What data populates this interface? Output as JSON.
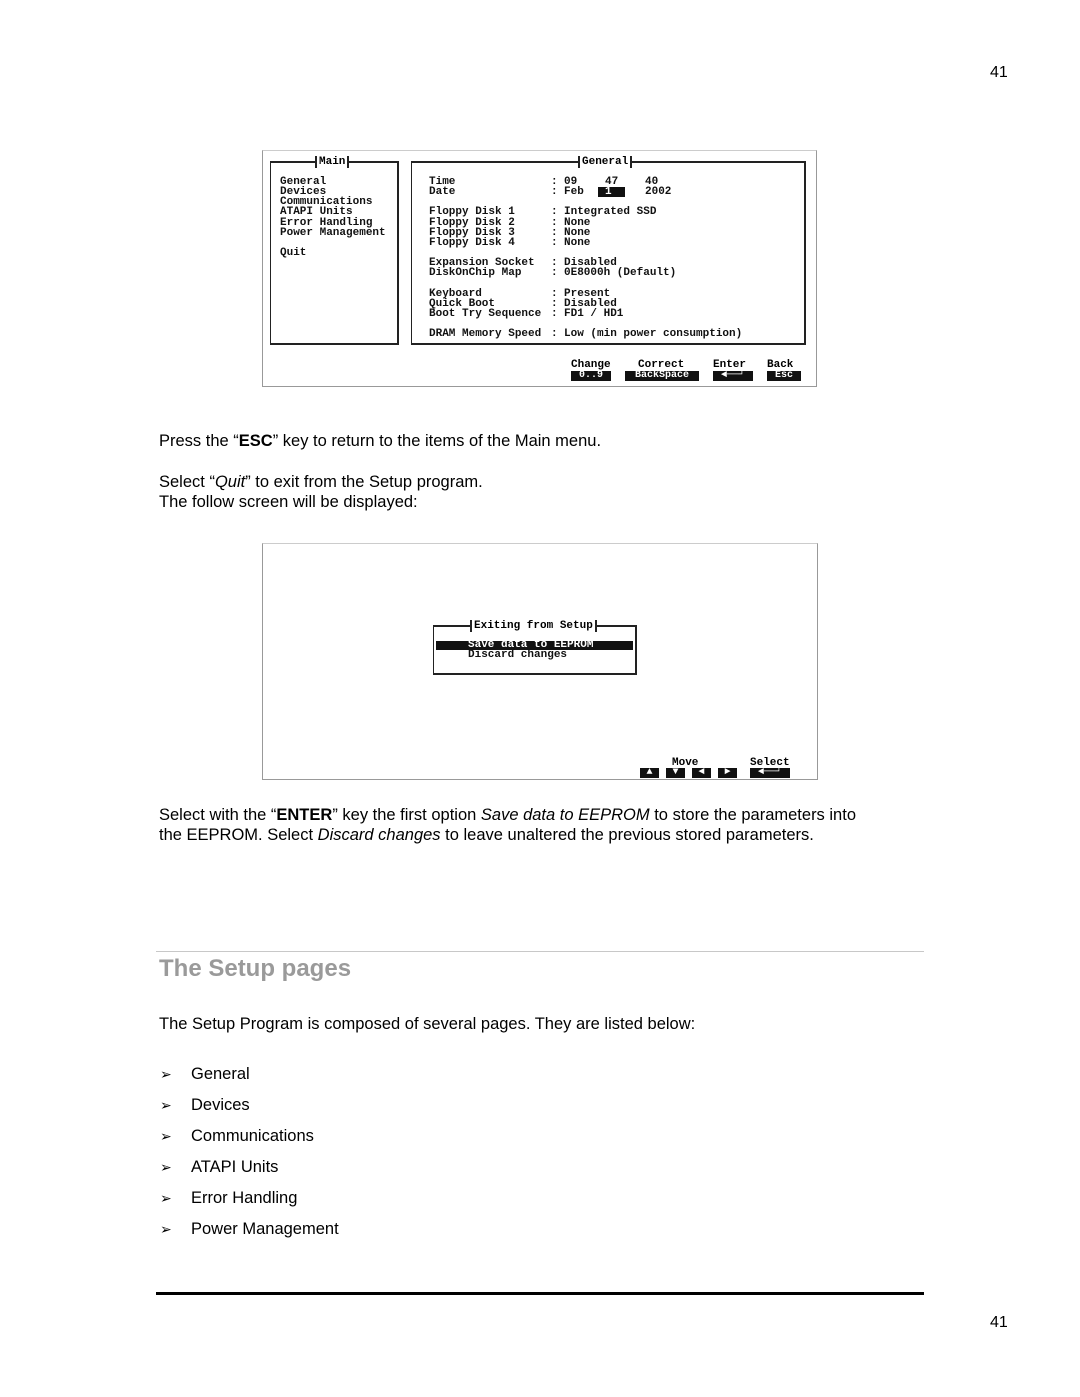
{
  "page_number": "41",
  "screen1": {
    "main_title": "Main",
    "main_items": [
      "General",
      "Devices",
      "Communications",
      "ATAPI Units",
      "Error Handling",
      "Power Management",
      "",
      "Quit"
    ],
    "general_title": "General",
    "general_rows": [
      {
        "label": "Time",
        "v1": "09",
        "v2": "47",
        "v3": "40"
      },
      {
        "label": "Date",
        "v1": "Feb",
        "v2": "1",
        "v3": "2002"
      },
      {
        "label": "",
        "value": ""
      },
      {
        "label": "Floppy Disk 1",
        "value": "Integrated SSD"
      },
      {
        "label": "Floppy Disk 2",
        "value": "None"
      },
      {
        "label": "Floppy Disk 3",
        "value": "None"
      },
      {
        "label": "Floppy Disk 4",
        "value": "None"
      },
      {
        "label": "",
        "value": ""
      },
      {
        "label": "Expansion Socket",
        "value": "Disabled"
      },
      {
        "label": "DiskOnChip Map",
        "value": "0E8000h (Default)"
      },
      {
        "label": "",
        "value": ""
      },
      {
        "label": "Keyboard",
        "value": "Present"
      },
      {
        "label": "Quick Boot",
        "value": "Disabled"
      },
      {
        "label": "Boot Try Sequence",
        "value": "FD1 / HD1"
      },
      {
        "label": "",
        "value": ""
      },
      {
        "label": "DRAM Memory Speed",
        "value": "Low (min power consumption)"
      }
    ],
    "keys": [
      {
        "label": "Change",
        "key": "0..9"
      },
      {
        "label": "Correct",
        "key": "BackSpace"
      },
      {
        "label": "Enter",
        "key": "◄──┘"
      },
      {
        "label": "Back",
        "key": "Esc"
      }
    ]
  },
  "para1": {
    "pre": "Press the “",
    "bold": "ESC",
    "post": "” key to return to the items of the Main menu."
  },
  "para2": {
    "pre": "Select “",
    "italic": "Quit",
    "post": "” to exit from the Setup program."
  },
  "para3": "The follow screen will be displayed:",
  "screen2": {
    "dialog_title": "Exiting from Setup",
    "options": [
      "Save data to EEPROM",
      "Discard changes"
    ],
    "selected_index": 0,
    "move_label": "Move",
    "move_keys": [
      "▲",
      "▼",
      "◄",
      "►"
    ],
    "select_label": "Select",
    "select_key": "◄──┘"
  },
  "para4": {
    "t1": "Select with the “",
    "b1": "ENTER",
    "t2": "” key the first option ",
    "i1": "Save data to EEPROM",
    "t3": " to store the parameters into",
    "t4": "the EEPROM. Select ",
    "i2": "Discard changes",
    "t5": " to leave unaltered the previous stored parameters."
  },
  "section_title": "The Setup pages",
  "section_intro": "The Setup Program is composed of several pages. They are listed below:",
  "bullet_marker": "➢",
  "pages_list": [
    "General",
    "Devices",
    "Communications",
    "ATAPI Units",
    "Error Handling",
    "Power Management"
  ]
}
